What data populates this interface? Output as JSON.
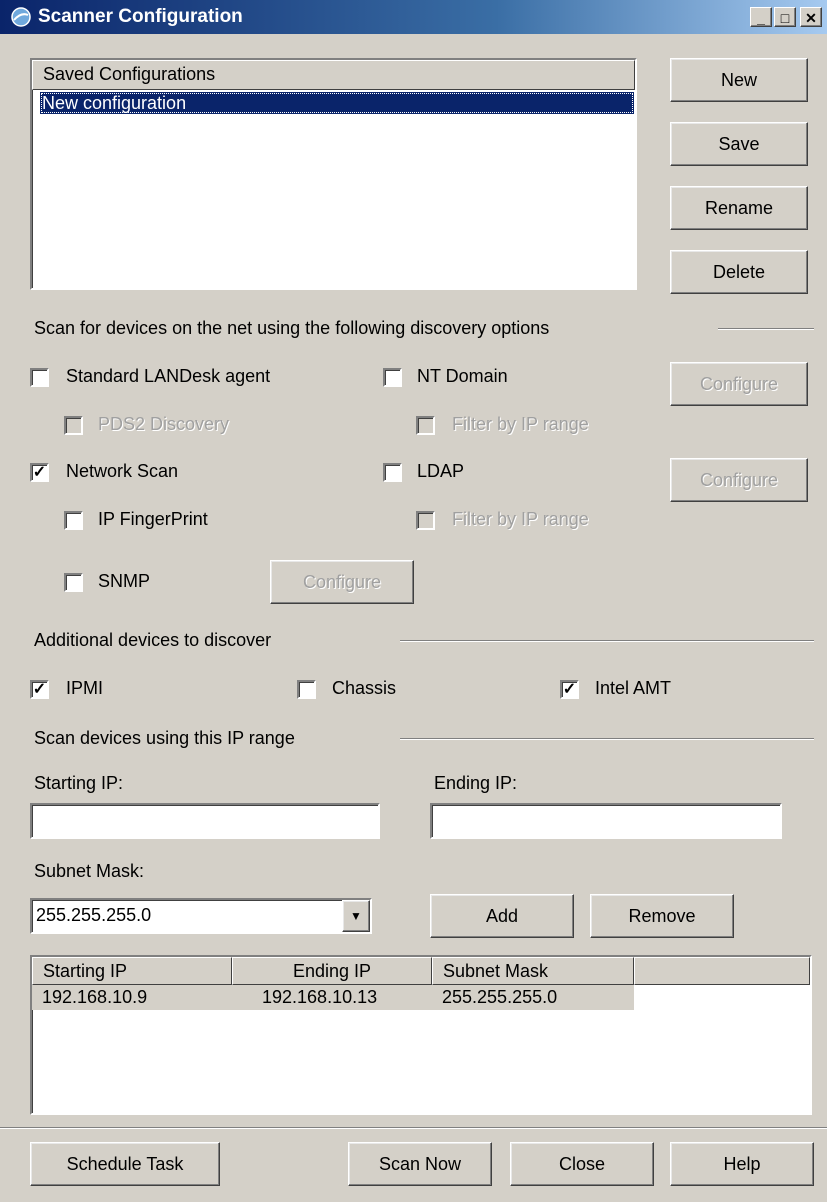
{
  "window": {
    "title": "Scanner Configuration",
    "controls": [
      "_",
      "□",
      "X"
    ]
  },
  "saved": {
    "header": "Saved Configurations",
    "items": [
      "New configuration"
    ]
  },
  "buttons": {
    "new": "New",
    "save": "Save",
    "rename": "Rename",
    "delete": "Delete"
  },
  "discovery": {
    "heading": "Scan for devices on the net using the following discovery options",
    "standard_landesk": {
      "label": "Standard LANDesk agent",
      "checked": false
    },
    "pds2": {
      "label": "PDS2 Discovery",
      "checked": false
    },
    "network_scan": {
      "label": "Network Scan",
      "checked": true
    },
    "ip_fingerprint": {
      "label": "IP FingerPrint",
      "checked": false
    },
    "snmp": {
      "label": "SNMP",
      "checked": false
    },
    "snmp_configure": "Configure",
    "nt_domain": {
      "label": "NT Domain",
      "checked": false
    },
    "nt_filter": {
      "label": "Filter by IP range",
      "checked": false
    },
    "ldap": {
      "label": "LDAP",
      "checked": false
    },
    "ldap_filter": {
      "label": "Filter by IP range",
      "checked": false
    },
    "configure1": "Configure",
    "configure2": "Configure"
  },
  "additional": {
    "heading": "Additional devices to discover",
    "ipmi": {
      "label": "IPMI",
      "checked": true
    },
    "chassis": {
      "label": "Chassis",
      "checked": false
    },
    "intel_amt": {
      "label": "Intel AMT",
      "checked": true
    }
  },
  "iprange": {
    "heading": "Scan devices using this IP range",
    "starting_label": "Starting IP:",
    "ending_label": "Ending IP:",
    "starting_value": "",
    "ending_value": "",
    "subnet_label": "Subnet Mask:",
    "subnet_value": "255.255.255.0",
    "add": "Add",
    "remove": "Remove"
  },
  "table": {
    "columns": [
      "Starting IP",
      "Ending IP",
      "Subnet Mask"
    ],
    "rows": [
      [
        "192.168.10.9",
        "192.168.10.13",
        "255.255.255.0"
      ]
    ]
  },
  "footer": {
    "schedule": "Schedule Task",
    "scan_now": "Scan Now",
    "close": "Close",
    "help": "Help"
  }
}
